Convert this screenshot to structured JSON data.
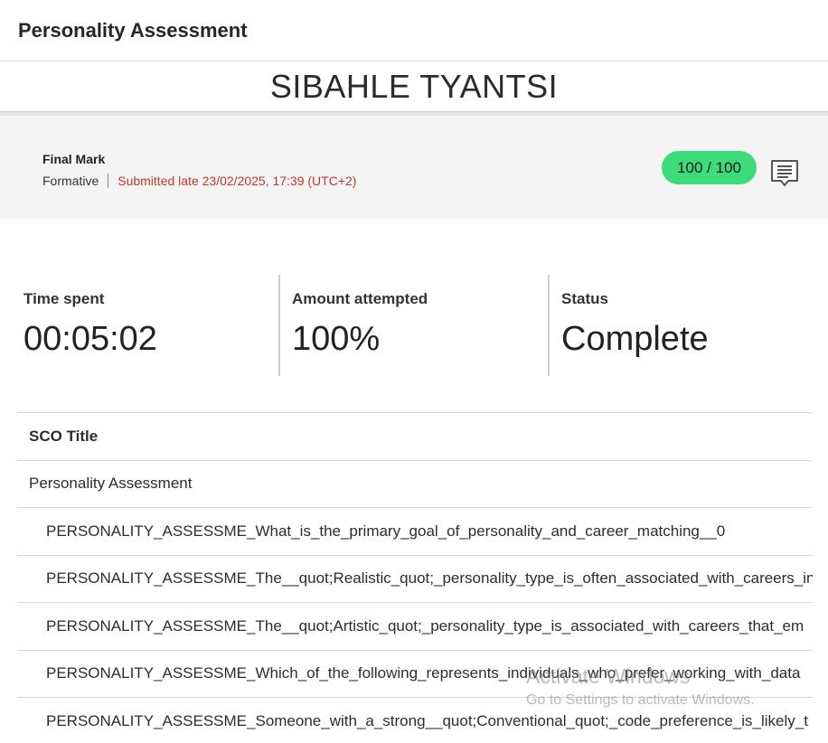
{
  "header": {
    "title": "Personality Assessment"
  },
  "student": {
    "name": "SIBAHLE TYANTSI"
  },
  "mark": {
    "label": "Final Mark",
    "type": "Formative",
    "submitted": "Submitted late 23/02/2025, 17:39 (UTC+2)",
    "score": "100 / 100",
    "comment_icon": "comment-icon"
  },
  "stats": [
    {
      "label": "Time spent",
      "value": "00:05:02"
    },
    {
      "label": "Amount attempted",
      "value": "100%"
    },
    {
      "label": "Status",
      "value": "Complete"
    }
  ],
  "table": {
    "header": "SCO Title",
    "parent": "Personality Assessment",
    "rows": [
      "PERSONALITY_ASSESSME_What_is_the_primary_goal_of_personality_and_career_matching__0",
      "PERSONALITY_ASSESSME_The__quot;Realistic_quot;_personality_type_is_often_associated_with_careers_in",
      "PERSONALITY_ASSESSME_The__quot;Artistic_quot;_personality_type_is_associated_with_careers_that_em",
      "PERSONALITY_ASSESSME_Which_of_the_following_represents_individuals_who_prefer_working_with_data",
      "PERSONALITY_ASSESSME_Someone_with_a_strong__quot;Conventional_quot;_code_preference_is_likely_t"
    ]
  },
  "watermark": {
    "line1": "Activate Windows",
    "line2": "Go to Settings to activate Windows."
  },
  "colors": {
    "score_pill": "#3ddc7a",
    "late_text": "#c0392b",
    "markbar_bg": "#f4f4f4"
  }
}
